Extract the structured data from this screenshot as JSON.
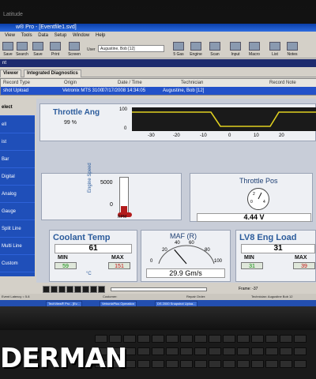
{
  "laptop": {
    "brand": "Latitude",
    "watermark": "DERMAN"
  },
  "window": {
    "title": "w® Pro - [Eventfile1.svd]"
  },
  "menu": [
    "View",
    "Tools",
    "Data",
    "Setup",
    "Window",
    "Help"
  ],
  "toolbar": {
    "buttons": [
      "Save",
      "Search",
      "Save",
      "Print",
      "Screen",
      "5 Gas",
      "Engine",
      "Scan",
      "Input",
      "Macro",
      "List",
      "Notes"
    ],
    "user_label": "User",
    "user_value": "Augustine, Bob [12]"
  },
  "nav": {
    "label": "nt"
  },
  "tabs": {
    "viewer": "Viewer",
    "diagnostics": "Integrated Diagnostics"
  },
  "grid": {
    "headers": [
      "Record Type",
      "Origin",
      "Date / Time",
      "Technician",
      "Record Note"
    ],
    "row": [
      "shot Upload",
      "Vetronix MTS 3100",
      "07/17/2008 14:34:05",
      "Augustine, Bob [12]",
      ""
    ]
  },
  "sidebar": [
    "elect",
    "ell",
    "ist",
    "Bar",
    "Digital",
    "Analog",
    "Gauge",
    "Split Line",
    "Multi Line",
    "Custom"
  ],
  "throttle_ang": {
    "title": "Throttle Ang",
    "unit": "%",
    "value": "99",
    "y_top": "100",
    "y_bottom": "0",
    "x_ticks": [
      "-30",
      "-20",
      "-10",
      "0",
      "10",
      "20"
    ]
  },
  "engine_speed": {
    "label": "Engine Speed",
    "max": "5000",
    "zero": "0",
    "unit": "RPM",
    "level": 0.18
  },
  "throttle_pos": {
    "title": "Throttle Pos",
    "value": "4.44 V",
    "dial": [
      "2",
      "0",
      "4"
    ]
  },
  "coolant": {
    "title": "Coolant Temp",
    "value": "61",
    "min_label": "MIN",
    "min": "59",
    "max_label": "MAX",
    "max": "151",
    "unit": "°C"
  },
  "maf": {
    "title": "MAF (R)",
    "value": "29.9 Gm/s",
    "scale": [
      "0",
      "20",
      "40",
      "60",
      "80",
      "100"
    ],
    "reading": 29.9
  },
  "lv8": {
    "title": "LV8 Eng Load",
    "value": "31",
    "min_label": "MIN",
    "min": "31",
    "max_label": "MAX",
    "max": "39"
  },
  "playback": {
    "frame": "Frame: -37"
  },
  "status": {
    "left": "Event Latency = 5.8",
    "customer": "Customer:",
    "repair": "Repair Order:",
    "tech": "Technician: Augustine Bob 12"
  },
  "taskbar": [
    "TechView® Pro - [Ev...",
    "VetronixPlus Operation",
    "DS 2000 Snapshot Uploa..."
  ],
  "colors": {
    "sidebar": "#1f4fb9",
    "selection": "#2352c9",
    "panel_title": "#2c5c9c"
  }
}
